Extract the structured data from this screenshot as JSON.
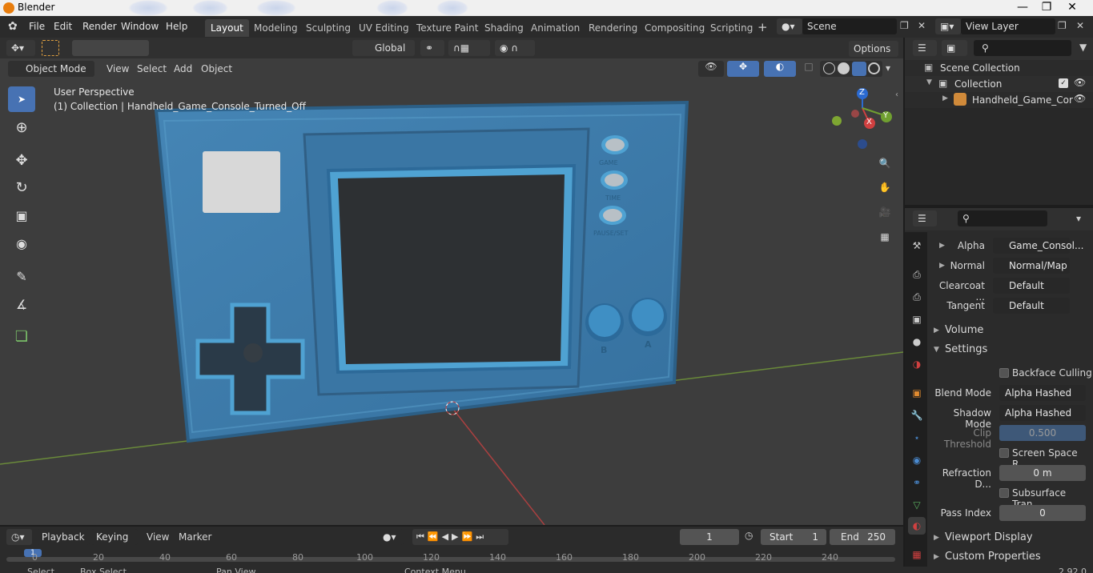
{
  "window": {
    "title": "Blender"
  },
  "menu": [
    "File",
    "Edit",
    "Render",
    "Window",
    "Help"
  ],
  "workspaces": [
    "Layout",
    "Modeling",
    "Sculpting",
    "UV Editing",
    "Texture Paint",
    "Shading",
    "Animation",
    "Rendering",
    "Compositing",
    "Scripting"
  ],
  "active_workspace": "Layout",
  "scene_name": "Scene",
  "view_layer": "View Layer",
  "toolheader": {
    "transform": "Global",
    "options": "Options"
  },
  "viewport_header": {
    "mode": "Object Mode",
    "items": [
      "View",
      "Select",
      "Add",
      "Object"
    ]
  },
  "viewport_info": {
    "line1": "User Perspective",
    "line2": "(1) Collection | Handheld_Game_Console_Turned_Off"
  },
  "console_labels": {
    "game": "GAME",
    "time": "TIME",
    "pause": "PAUSE/SET",
    "b": "B",
    "a": "A"
  },
  "gizmo": {
    "x": "X",
    "y": "Y",
    "z": "Z"
  },
  "outliner": {
    "scene_collection": "Scene Collection",
    "collection": "Collection",
    "object": "Handheld_Game_Cor"
  },
  "properties": {
    "rows": [
      {
        "label": "Alpha",
        "value": "Game_Consol..."
      },
      {
        "label": "Normal",
        "value": "Normal/Map"
      },
      {
        "label": "Clearcoat ...",
        "value": "Default"
      },
      {
        "label": "Tangent",
        "value": "Default"
      }
    ],
    "volume": "Volume",
    "settings": "Settings",
    "backface": "Backface Culling",
    "blend_mode_label": "Blend Mode",
    "blend_mode": "Alpha Hashed",
    "shadow_mode_label": "Shadow Mode",
    "shadow_mode": "Alpha Hashed",
    "clip_label": "Clip Threshold",
    "clip_value": "0.500",
    "screen_space": "Screen Space R...",
    "refraction_label": "Refraction D...",
    "refraction_value": "0 m",
    "subsurface": "Subsurface Tran...",
    "pass_label": "Pass Index",
    "pass_value": "0",
    "viewport_display": "Viewport Display",
    "custom_props": "Custom Properties"
  },
  "timeline": {
    "items": [
      "Playback",
      "Keying",
      "View",
      "Marker"
    ],
    "current_frame": "1",
    "start_label": "Start",
    "start": "1",
    "end_label": "End",
    "end": "250",
    "ticks": [
      "0",
      "20",
      "40",
      "60",
      "80",
      "100",
      "120",
      "140",
      "160",
      "180",
      "200",
      "220",
      "240"
    ]
  },
  "statusbar": {
    "select": "Select",
    "box": "Box Select",
    "pan": "Pan View",
    "context": "Context Menu",
    "version": "2.92.0"
  },
  "colors": {
    "accent": "#4772b3",
    "console": "#3a7fb0",
    "header_bg": "#2b2b2b"
  }
}
